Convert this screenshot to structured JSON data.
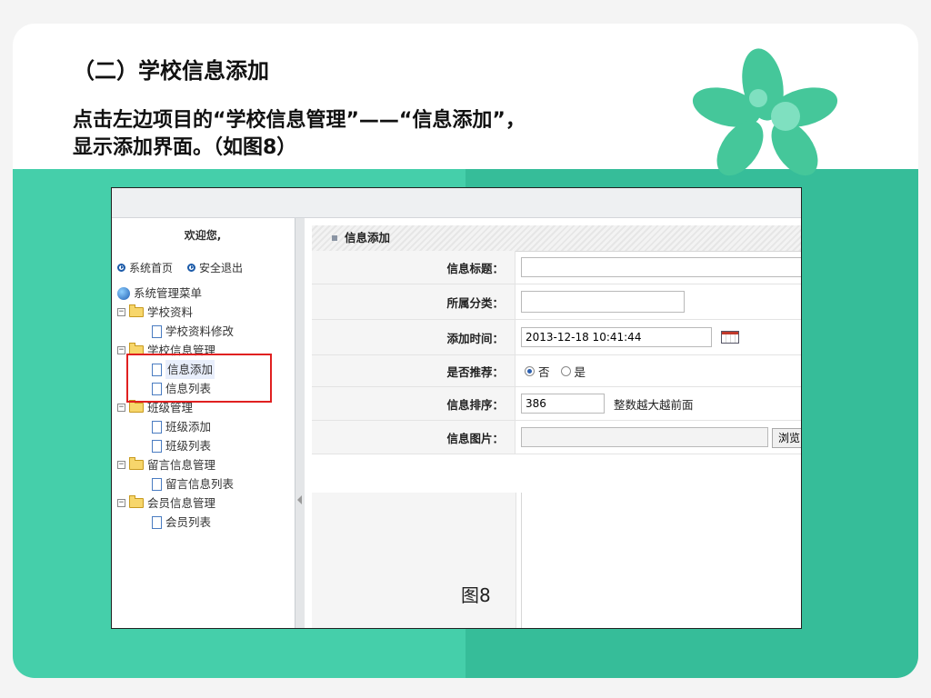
{
  "slide": {
    "title": "（二）学校信息添加",
    "desc_line1": "点击左边项目的“学校信息管理”——“信息添加”，",
    "desc_line2": "显示添加界面。（如图8）",
    "figure_label": "图8"
  },
  "colors": {
    "band_left": "#45cfaa",
    "band_right": "#36bd99",
    "highlight_box": "#e02020",
    "leaf_icon": "#45c79a"
  },
  "icons": {
    "decoration": "leaf-cluster-icon",
    "link_arrow": "circle-arrow-icon",
    "tree_root": "globe-icon",
    "folder": "folder-icon",
    "page": "page-icon",
    "calendar": "calendar-icon"
  },
  "sidebar": {
    "welcome": "欢迎您,",
    "links": [
      "系统首页",
      "安全退出"
    ],
    "root": "系统管理菜单",
    "groups": [
      {
        "label": "学校资料",
        "items": [
          "学校资料修改"
        ]
      },
      {
        "label": "学校信息管理",
        "items": [
          "信息添加",
          "信息列表"
        ]
      },
      {
        "label": "班级管理",
        "items": [
          "班级添加",
          "班级列表"
        ]
      },
      {
        "label": "留言信息管理",
        "items": [
          "留言信息列表"
        ]
      },
      {
        "label": "会员信息管理",
        "items": [
          "会员列表"
        ]
      }
    ]
  },
  "form": {
    "panel_title": "信息添加",
    "fields": {
      "title_label": "信息标题：",
      "category_label": "所属分类：",
      "time_label": "添加时间：",
      "time_value": "2013-12-18 10:41:44",
      "recommend_label": "是否推荐：",
      "recommend_options": [
        "否",
        "是"
      ],
      "recommend_selected": "否",
      "order_label": "信息排序：",
      "order_value": "386",
      "order_hint": "整数越大越前面",
      "image_label": "信息图片：",
      "browse_button": "浏览"
    }
  }
}
